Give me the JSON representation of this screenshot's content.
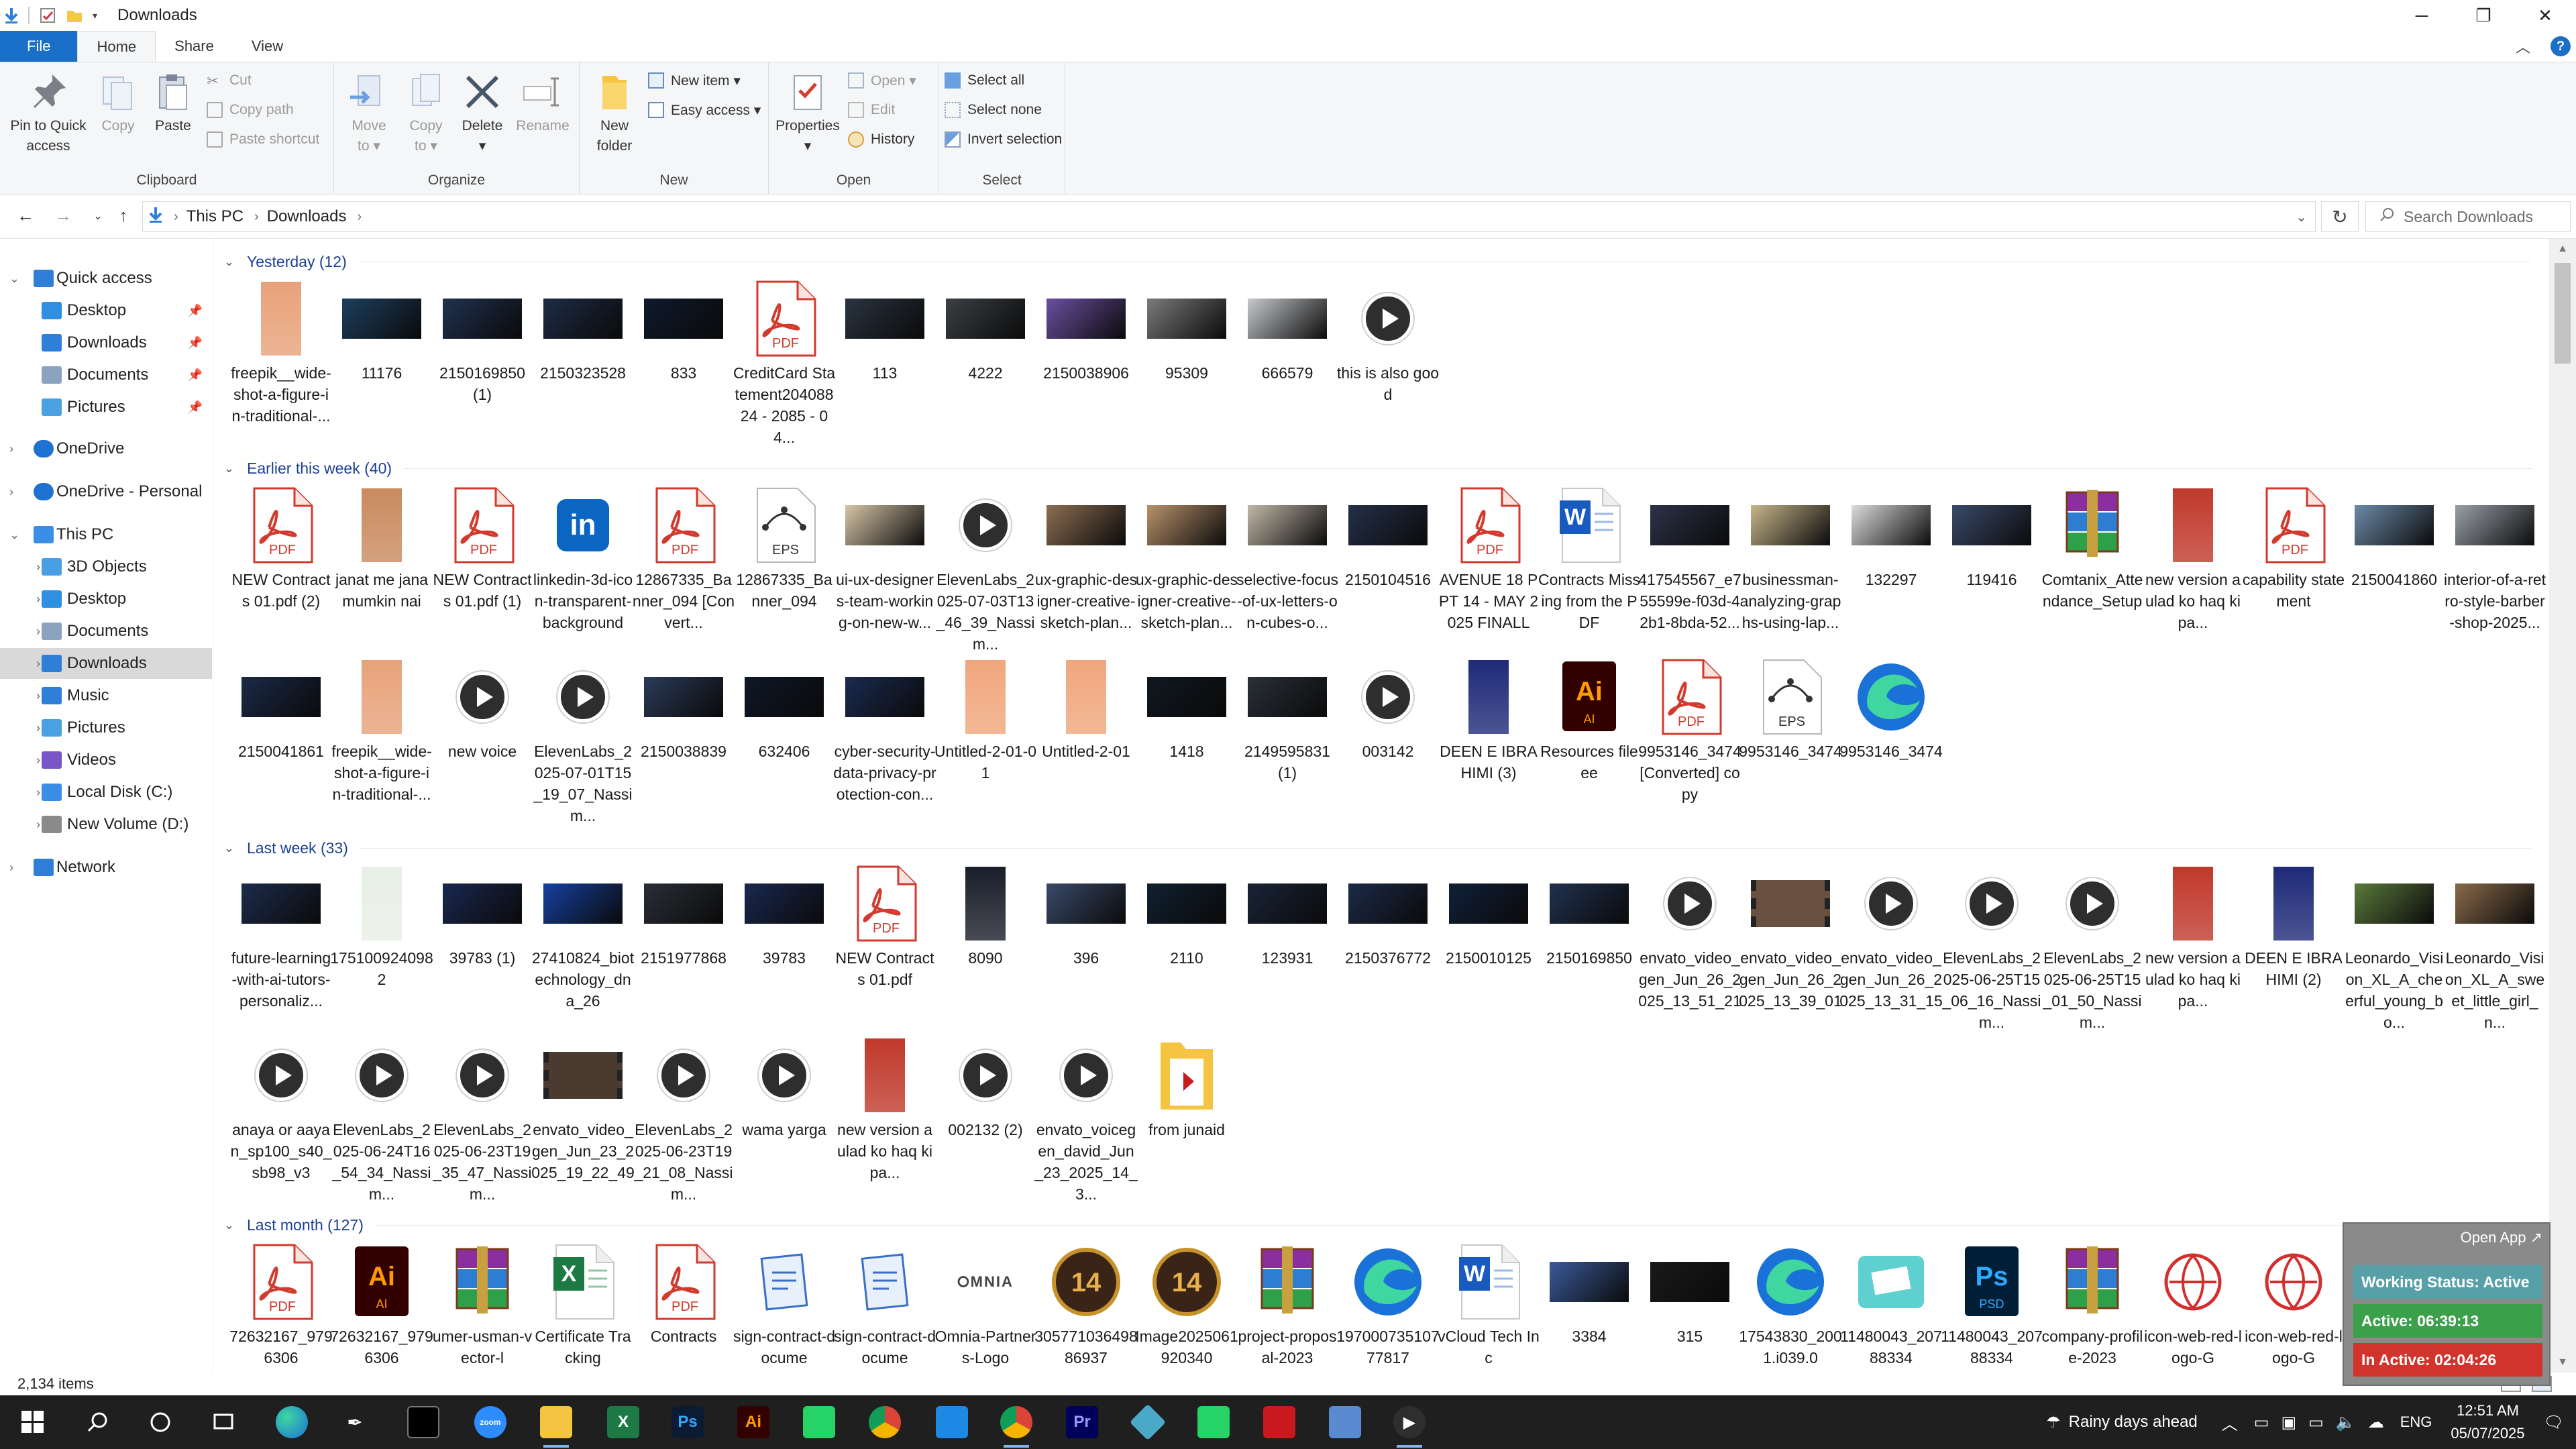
{
  "window": {
    "title": "Downloads",
    "controls": {
      "minimize": "─",
      "maximize": "❐",
      "close": "✕"
    }
  },
  "ribbon_tabs": [
    "File",
    "Home",
    "Share",
    "View"
  ],
  "ribbon": {
    "clipboard": {
      "group": "Clipboard",
      "pin_line1": "Pin to Quick",
      "pin_line2": "access",
      "copy": "Copy",
      "paste": "Paste",
      "cut": "Cut",
      "copy_path": "Copy path",
      "paste_shortcut": "Paste shortcut"
    },
    "organize": {
      "group": "Organize",
      "move_line1": "Move",
      "move_line2": "to ▾",
      "copy_line1": "Copy",
      "copy_line2": "to ▾",
      "delete": "Delete",
      "delete_line2": "▾",
      "rename": "Rename"
    },
    "new": {
      "group": "New",
      "folder_line1": "New",
      "folder_line2": "folder",
      "new_item": "New item ▾",
      "easy_access": "Easy access ▾"
    },
    "open": {
      "group": "Open",
      "properties": "Properties",
      "properties_line2": "▾",
      "open": "Open ▾",
      "edit": "Edit",
      "history": "History"
    },
    "select": {
      "group": "Select",
      "select_all": "Select all",
      "select_none": "Select none",
      "invert": "Invert selection"
    }
  },
  "address": {
    "path": [
      "This PC",
      "Downloads"
    ],
    "search_placeholder": "Search Downloads"
  },
  "nav_pane": [
    {
      "label": "Quick access",
      "level": 0,
      "icon": "star-icon",
      "color": "#2f7fd8"
    },
    {
      "label": "Desktop",
      "level": 1,
      "icon": "desktop-icon",
      "color": "#2f8fe0",
      "pinned": true
    },
    {
      "label": "Downloads",
      "level": 1,
      "icon": "download-icon",
      "color": "#2f7fd8",
      "pinned": true
    },
    {
      "label": "Documents",
      "level": 1,
      "icon": "document-icon",
      "color": "#8aa3c0",
      "pinned": true
    },
    {
      "label": "Pictures",
      "level": 1,
      "icon": "picture-icon",
      "color": "#4aa0e0",
      "pinned": true
    },
    {
      "label": "OneDrive",
      "level": 0,
      "icon": "cloud-icon",
      "color": "#1f72d1"
    },
    {
      "label": "OneDrive - Personal",
      "level": 0,
      "icon": "cloud-icon",
      "color": "#1f72d1"
    },
    {
      "label": "This PC",
      "level": 0,
      "icon": "computer-icon",
      "color": "#3a8ee6"
    },
    {
      "label": "3D Objects",
      "level": 1,
      "icon": "cube-icon",
      "color": "#4a9fe4"
    },
    {
      "label": "Desktop",
      "level": 1,
      "icon": "desktop-icon",
      "color": "#2f8fe0"
    },
    {
      "label": "Documents",
      "level": 1,
      "icon": "document-icon",
      "color": "#8aa3c0"
    },
    {
      "label": "Downloads",
      "level": 1,
      "icon": "download-icon",
      "color": "#2f7fd8",
      "selected": true
    },
    {
      "label": "Music",
      "level": 1,
      "icon": "music-icon",
      "color": "#2f7fd8"
    },
    {
      "label": "Pictures",
      "level": 1,
      "icon": "picture-icon",
      "color": "#4aa0e0"
    },
    {
      "label": "Videos",
      "level": 1,
      "icon": "video-icon",
      "color": "#7a55c8"
    },
    {
      "label": "Local Disk (C:)",
      "level": 1,
      "icon": "drive-icon",
      "color": "#3a8ee6"
    },
    {
      "label": "New Volume (D:)",
      "level": 1,
      "icon": "drive-icon",
      "color": "#8a8a8a"
    },
    {
      "label": "Network",
      "level": 0,
      "icon": "network-icon",
      "color": "#2f7fd8"
    }
  ],
  "groups": [
    {
      "title": "Yesterday (12)",
      "rows": [
        [
          {
            "name": "freepik__wide-shot-a-figure-in-traditional-...",
            "kind": "portrait",
            "color": "#e8a27a"
          },
          {
            "name": "11176",
            "kind": "image",
            "color": "#1c3f5e"
          },
          {
            "name": "2150169850 (1)",
            "kind": "image",
            "color": "#20314f"
          },
          {
            "name": "2150323528",
            "kind": "image",
            "color": "#1d2c45"
          },
          {
            "name": "833",
            "kind": "image",
            "color": "#0e1a2d"
          },
          {
            "name": "CreditCard Statement20408824 - 2085 - 04...",
            "kind": "pdf"
          },
          {
            "name": "113",
            "kind": "image",
            "color": "#2a3440"
          },
          {
            "name": "4222",
            "kind": "image",
            "color": "#3b3f44"
          },
          {
            "name": "2150038906",
            "kind": "image",
            "color": "#6b4fa0"
          },
          {
            "name": "95309",
            "kind": "image",
            "color": "#7a7a7a"
          },
          {
            "name": "666579",
            "kind": "image",
            "color": "#c7c9cc"
          },
          {
            "name": "this is also good",
            "kind": "video"
          }
        ]
      ]
    },
    {
      "title": "Earlier this week (40)",
      "rows": [
        [
          {
            "name": "NEW Contracts 01.pdf (2)",
            "kind": "pdf"
          },
          {
            "name": "janat me jana mumkin nai",
            "kind": "portrait",
            "color": "#c98a5e"
          },
          {
            "name": "NEW Contracts 01.pdf (1)",
            "kind": "pdf"
          },
          {
            "name": "linkedin-3d-icon-transparent-background",
            "kind": "linkedin"
          },
          {
            "name": "12867335_Banner_094 [Convert...",
            "kind": "pdf"
          },
          {
            "name": "12867335_Banner_094",
            "kind": "eps"
          },
          {
            "name": "ui-ux-designers-team-working-on-new-w...",
            "kind": "image",
            "color": "#d8c6a8"
          },
          {
            "name": "ElevenLabs_2025-07-03T13_46_39_Nassim...",
            "kind": "video"
          },
          {
            "name": "ux-graphic-designer-creative-sketch-plan...",
            "kind": "image",
            "color": "#8c6e52"
          },
          {
            "name": "ux-graphic-designer-creative-sketch-plan...",
            "kind": "image",
            "color": "#b8926a"
          },
          {
            "name": "selective-focus-of-ux-letters-on-cubes-o...",
            "kind": "image",
            "color": "#c2b8a8"
          },
          {
            "name": "2150104516",
            "kind": "image",
            "color": "#24304a"
          },
          {
            "name": "AVENUE 18 PPT 14 - MAY 2025 FINALL",
            "kind": "pdf"
          },
          {
            "name": "Contracts Missing from the PDF",
            "kind": "word"
          },
          {
            "name": "417545567_e755599e-f03d-42b1-8bda-52...",
            "kind": "image",
            "color": "#2c3348"
          },
          {
            "name": "businessman-analyzing-graphs-using-lap...",
            "kind": "image",
            "color": "#c8b68a"
          },
          {
            "name": "132297",
            "kind": "image",
            "color": "#dcdcdc"
          },
          {
            "name": "119416",
            "kind": "image",
            "color": "#3a4a6a"
          },
          {
            "name": "Comtanix_Attendance_Setup",
            "kind": "rar"
          },
          {
            "name": "new version aulad ko haq ki pa...",
            "kind": "portrait",
            "color": "#c0392b"
          },
          {
            "name": "capability statement",
            "kind": "pdf"
          },
          {
            "name": "2150041860",
            "kind": "image",
            "color": "#6c8aa8"
          },
          {
            "name": "interior-of-a-retro-style-barber-shop-2025...",
            "kind": "image",
            "color": "#9aa0a8"
          }
        ],
        [
          {
            "name": "2150041861",
            "kind": "image",
            "color": "#1a2a48"
          },
          {
            "name": "freepik__wide-shot-a-figure-in-traditional-...",
            "kind": "portrait",
            "color": "#e8a27a"
          },
          {
            "name": "new voice",
            "kind": "video"
          },
          {
            "name": "ElevenLabs_2025-07-01T15_19_07_Nassim...",
            "kind": "video"
          },
          {
            "name": "2150038839",
            "kind": "image",
            "color": "#2a3a58"
          },
          {
            "name": "632406",
            "kind": "image",
            "color": "#0e1828"
          },
          {
            "name": "cyber-security-data-privacy-protection-con...",
            "kind": "image",
            "color": "#1a2a50"
          },
          {
            "name": "Untitled-2-01-01",
            "kind": "portrait",
            "color": "#f0a67c"
          },
          {
            "name": "Untitled-2-01",
            "kind": "portrait",
            "color": "#f0a67c"
          },
          {
            "name": "1418",
            "kind": "image",
            "color": "#101820"
          },
          {
            "name": "2149595831 (1)",
            "kind": "image",
            "color": "#2a3038"
          },
          {
            "name": "003142",
            "kind": "video"
          },
          {
            "name": "DEEN E IBRAHIMI (3)",
            "kind": "portrait",
            "color": "#1e2a78"
          },
          {
            "name": "Resources fileee",
            "kind": "ai"
          },
          {
            "name": "9953146_3474 [Converted] copy",
            "kind": "pdf"
          },
          {
            "name": "9953146_3474",
            "kind": "eps"
          },
          {
            "name": "9953146_3474",
            "kind": "edge"
          }
        ]
      ]
    },
    {
      "title": "Last week (33)",
      "rows": [
        [
          {
            "name": "future-learning-with-ai-tutors-personaliz...",
            "kind": "image",
            "color": "#1c2c4c"
          },
          {
            "name": "1751009240982",
            "kind": "portrait",
            "color": "#e8efe6"
          },
          {
            "name": "39783 (1)",
            "kind": "image",
            "color": "#1a2850"
          },
          {
            "name": "27410824_biotechnology_dna_26",
            "kind": "image",
            "color": "#1540a0"
          },
          {
            "name": "2151977868",
            "kind": "image",
            "color": "#2a2e36"
          },
          {
            "name": "39783",
            "kind": "image",
            "color": "#1a2850"
          },
          {
            "name": "NEW Contracts 01.pdf",
            "kind": "pdf"
          },
          {
            "name": "8090",
            "kind": "portrait",
            "color": "#1a1e2a"
          },
          {
            "name": "396",
            "kind": "image",
            "color": "#3a4a6a"
          },
          {
            "name": "2110",
            "kind": "image",
            "color": "#102030"
          },
          {
            "name": "123931",
            "kind": "image",
            "color": "#1a2438"
          },
          {
            "name": "2150376772",
            "kind": "image",
            "color": "#1c2a48"
          },
          {
            "name": "2150010125",
            "kind": "image",
            "color": "#10203a"
          },
          {
            "name": "2150169850",
            "kind": "image",
            "color": "#20314f"
          },
          {
            "name": "envato_video_gen_Jun_26_2025_13_51_21",
            "kind": "video"
          },
          {
            "name": "envato_video_gen_Jun_26_2025_13_39_01",
            "kind": "film",
            "color": "#6a5040"
          },
          {
            "name": "envato_video_gen_Jun_26_2025_13_31_15",
            "kind": "video"
          },
          {
            "name": "ElevenLabs_2025-06-25T15_06_16_Nassim...",
            "kind": "video"
          },
          {
            "name": "ElevenLabs_2025-06-25T15_01_50_Nassim...",
            "kind": "video"
          },
          {
            "name": "new version aulad ko haq ki pa...",
            "kind": "portrait",
            "color": "#c0392b"
          },
          {
            "name": "DEEN E IBRAHIMI (2)",
            "kind": "portrait",
            "color": "#1e2a78"
          },
          {
            "name": "Leonardo_Vision_XL_A_cheerful_young_bo...",
            "kind": "image",
            "color": "#5a7a3a"
          },
          {
            "name": "Leonardo_Vision_XL_A_sweet_little_girl_n...",
            "kind": "image",
            "color": "#8a6a4a"
          }
        ],
        [
          {
            "name": "anaya or aayan_sp100_s40_sb98_v3",
            "kind": "video"
          },
          {
            "name": "ElevenLabs_2025-06-24T16_54_34_Nassim...",
            "kind": "video"
          },
          {
            "name": "ElevenLabs_2025-06-23T19_35_47_Nassim...",
            "kind": "video"
          },
          {
            "name": "envato_video_gen_Jun_23_2025_19_22_49",
            "kind": "film",
            "color": "#4a3a30"
          },
          {
            "name": "ElevenLabs_2025-06-23T19_21_08_Nassim...",
            "kind": "video"
          },
          {
            "name": "wama yarga",
            "kind": "video"
          },
          {
            "name": "new version aulad ko haq ki pa...",
            "kind": "portrait",
            "color": "#c0392b"
          },
          {
            "name": "002132 (2)",
            "kind": "video"
          },
          {
            "name": "envato_voicegen_david_Jun_23_2025_14_3...",
            "kind": "video"
          },
          {
            "name": "from junaid",
            "kind": "folder"
          }
        ]
      ]
    },
    {
      "title": "Last month (127)",
      "rows": [
        [
          {
            "name": "72632167_9796306",
            "kind": "pdf"
          },
          {
            "name": "72632167_9796306",
            "kind": "ai"
          },
          {
            "name": "umer-usman-vector-l",
            "kind": "rar"
          },
          {
            "name": "Certificate Tracking",
            "kind": "excel"
          },
          {
            "name": "Contracts",
            "kind": "pdf"
          },
          {
            "name": "sign-contract-docume",
            "kind": "doc"
          },
          {
            "name": "sign-contract-docume",
            "kind": "doc"
          },
          {
            "name": "Omnia-Partners-Logo",
            "kind": "omnia"
          },
          {
            "name": "30577103649886937",
            "kind": "badge"
          },
          {
            "name": "Image2025061920340",
            "kind": "badge"
          },
          {
            "name": "project-proposal-2023",
            "kind": "rar"
          },
          {
            "name": "19700073510777817",
            "kind": "edge"
          },
          {
            "name": "vCloud Tech Inc",
            "kind": "word"
          },
          {
            "name": "3384",
            "kind": "image",
            "color": "#3a5a9a"
          },
          {
            "name": "315",
            "kind": "image",
            "color": "#1a1a1a"
          },
          {
            "name": "17543830_2001.i039.0",
            "kind": "edge"
          },
          {
            "name": "11480043_20788334",
            "kind": "box"
          },
          {
            "name": "11480043_20788334",
            "kind": "psd"
          },
          {
            "name": "company-profile-2023",
            "kind": "rar"
          },
          {
            "name": "icon-web-red-logo-G",
            "kind": "webicon"
          },
          {
            "name": "icon-web-red-logo-G",
            "kind": "webicon"
          }
        ]
      ]
    }
  ],
  "status": {
    "items": "2,134 items"
  },
  "widget": {
    "open_app": "Open App ↗",
    "working_status": "Working Status: Active",
    "active": "Active: 06:39:13",
    "inactive": "In Active: 02:04:26"
  },
  "taskbar": {
    "weather": "Rainy days ahead",
    "lang": "ENG",
    "time": "12:51 AM",
    "date": "05/07/2025"
  }
}
